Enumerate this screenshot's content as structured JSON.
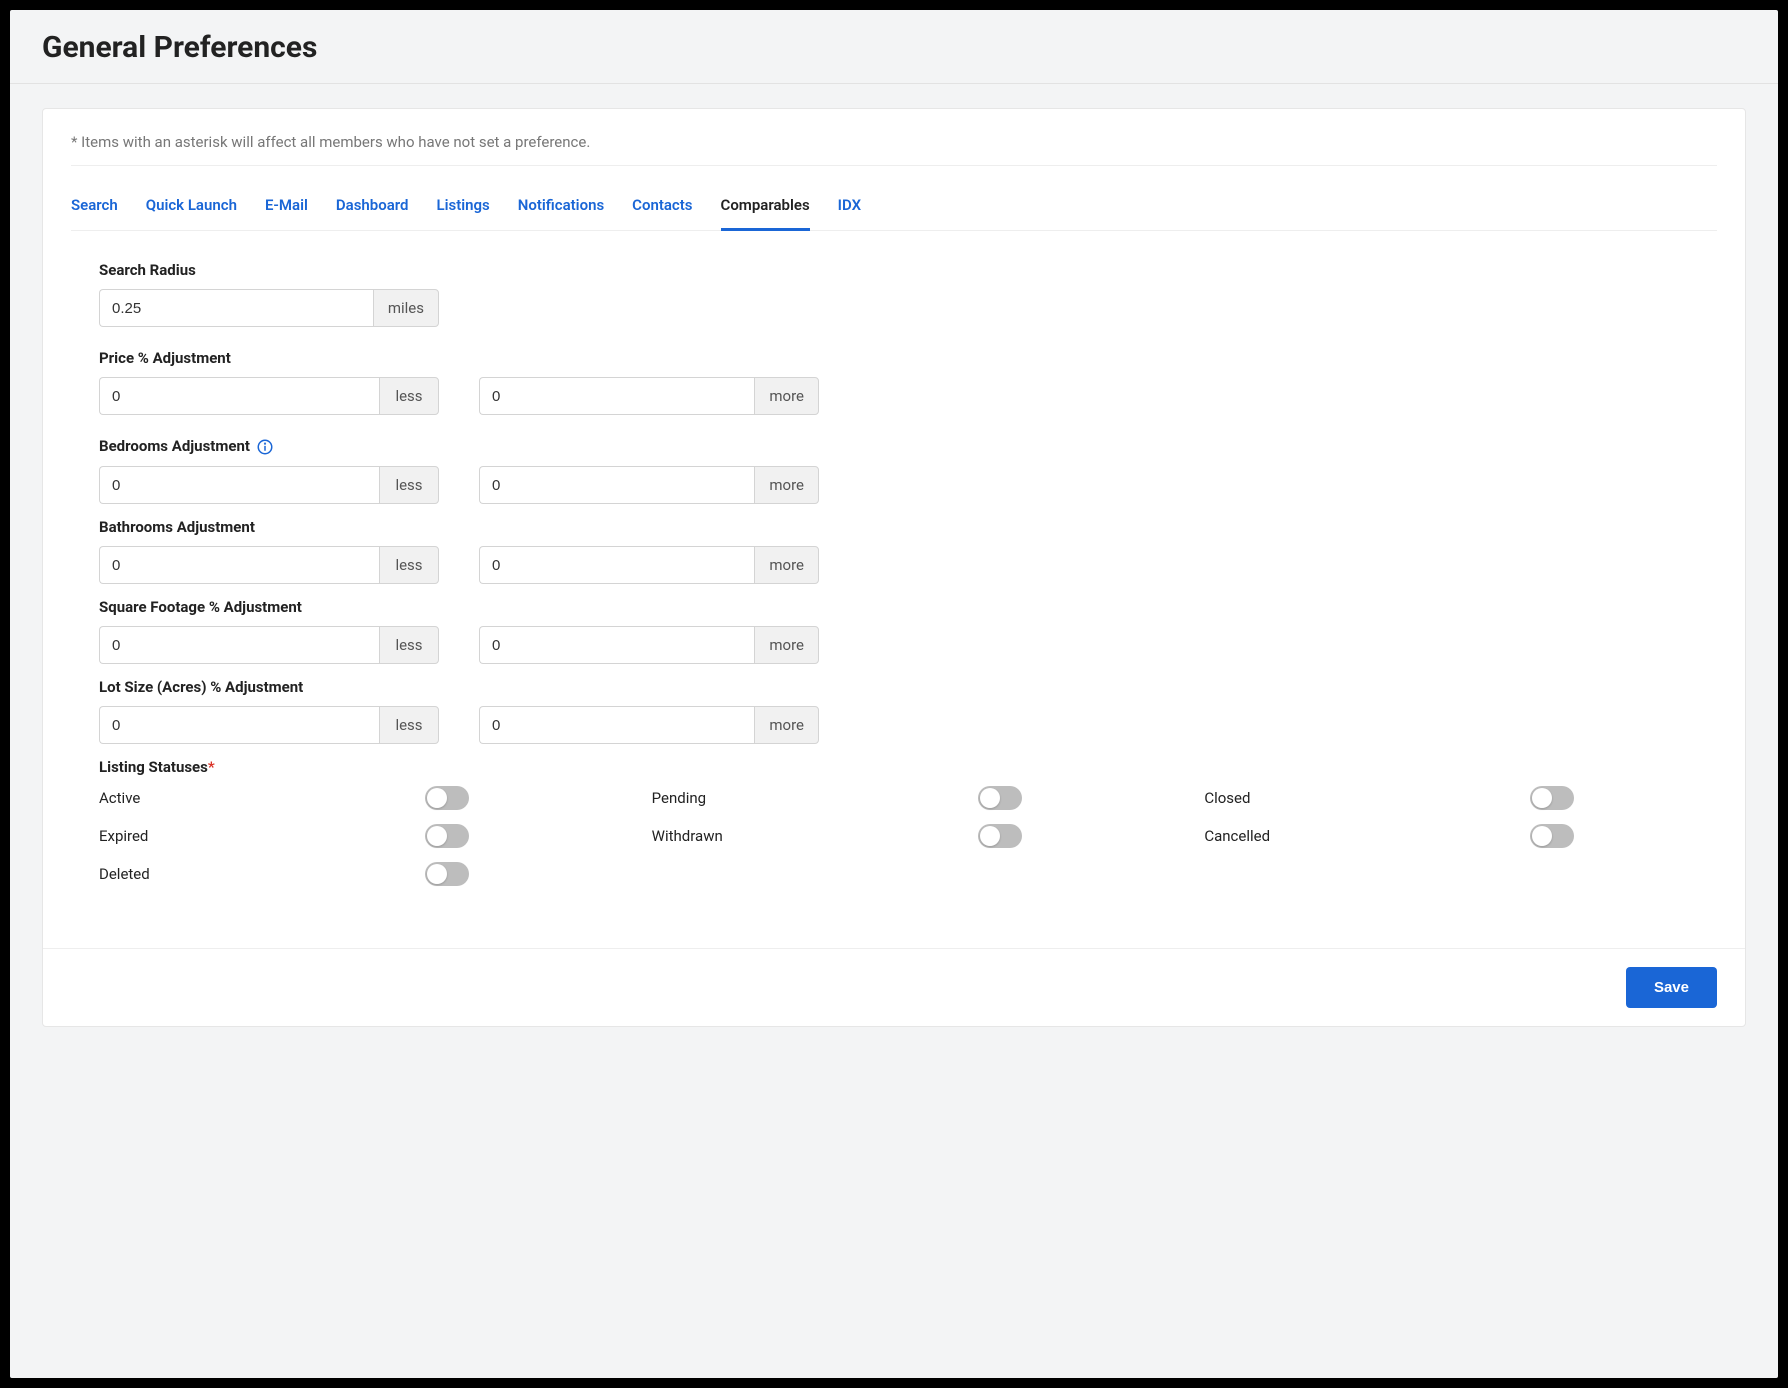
{
  "header": {
    "title": "General Preferences"
  },
  "disclaimer": "*  Items with an asterisk will affect all members who have not set a preference.",
  "tabs": [
    {
      "label": "Search",
      "active": false
    },
    {
      "label": "Quick Launch",
      "active": false
    },
    {
      "label": "E-Mail",
      "active": false
    },
    {
      "label": "Dashboard",
      "active": false
    },
    {
      "label": "Listings",
      "active": false
    },
    {
      "label": "Notifications",
      "active": false
    },
    {
      "label": "Contacts",
      "active": false
    },
    {
      "label": "Comparables",
      "active": true
    },
    {
      "label": "IDX",
      "active": false
    }
  ],
  "form": {
    "search_radius": {
      "label": "Search Radius",
      "value": "0.25",
      "unit": "miles"
    },
    "price_adjustment": {
      "label": "Price % Adjustment",
      "less": {
        "value": "0",
        "unit": "less"
      },
      "more": {
        "value": "0",
        "unit": "more"
      }
    },
    "bedrooms_adjustment": {
      "label": "Bedrooms Adjustment",
      "less": {
        "value": "0",
        "unit": "less"
      },
      "more": {
        "value": "0",
        "unit": "more"
      }
    },
    "bathrooms_adjustment": {
      "label": "Bathrooms Adjustment",
      "less": {
        "value": "0",
        "unit": "less"
      },
      "more": {
        "value": "0",
        "unit": "more"
      }
    },
    "sqft_adjustment": {
      "label": "Square Footage % Adjustment",
      "less": {
        "value": "0",
        "unit": "less"
      },
      "more": {
        "value": "0",
        "unit": "more"
      }
    },
    "lotsize_adjustment": {
      "label": "Lot Size (Acres) % Adjustment",
      "less": {
        "value": "0",
        "unit": "less"
      },
      "more": {
        "value": "0",
        "unit": "more"
      }
    },
    "listing_statuses": {
      "label": "Listing Statuses",
      "items": [
        {
          "label": "Active",
          "on": false
        },
        {
          "label": "Pending",
          "on": false
        },
        {
          "label": "Closed",
          "on": false
        },
        {
          "label": "Expired",
          "on": false
        },
        {
          "label": "Withdrawn",
          "on": false
        },
        {
          "label": "Cancelled",
          "on": false
        },
        {
          "label": "Deleted",
          "on": false
        }
      ]
    }
  },
  "footer": {
    "save_label": "Save"
  }
}
